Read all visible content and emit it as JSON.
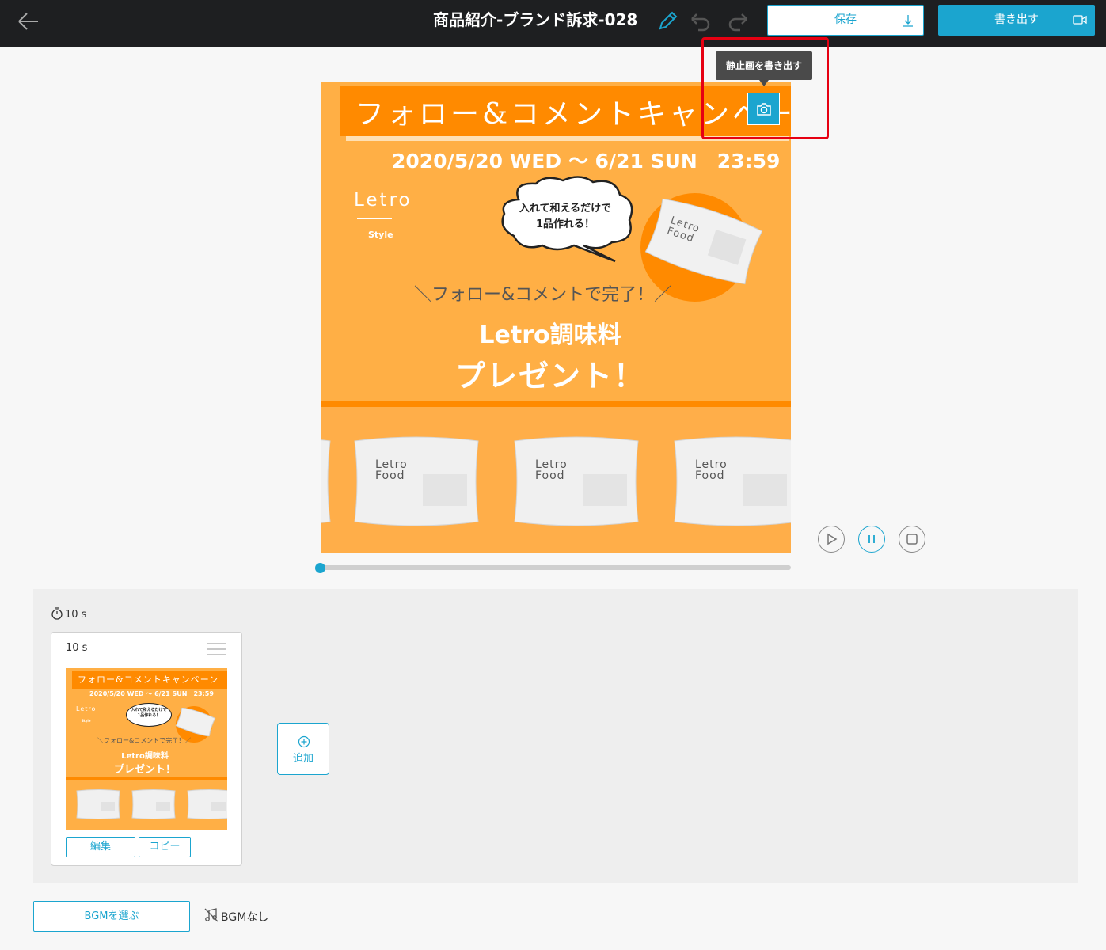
{
  "header": {
    "title": "商品紹介-ブランド訴求-028",
    "save_label": "保存",
    "export_label": "書き出す"
  },
  "canvas": {
    "banner_text": "フォロー&コメントキャンペーン",
    "date_text": "2020/5/20 WED 〜 6/21 SUN　23:59",
    "logo_text": "Letro",
    "logo_sub": "Style",
    "bubble_line1": "入れて和えるだけで",
    "bubble_line2": "1品作れる！",
    "pack_label": "Letro Food",
    "follow_text": "＼フォロー&コメントで完了！／",
    "gift_line1": "Letro調味料",
    "gift_line2": "プレゼント！"
  },
  "tooltip": {
    "text": "静止画を書き出す"
  },
  "playback": {
    "progress": 0.0
  },
  "timeline": {
    "total_duration": "10 s",
    "scene": {
      "duration": "10 s",
      "edit_label": "編集",
      "copy_label": "コピー"
    },
    "add_label": "追加"
  },
  "bgm": {
    "button_label": "BGMを選ぶ",
    "status": "BGMなし"
  },
  "colors": {
    "accent": "#1ba5cf",
    "header_bg": "#1e1f21",
    "canvas_bg": "#ffaf45",
    "banner": "#ff8a00",
    "highlight": "#e60012"
  }
}
